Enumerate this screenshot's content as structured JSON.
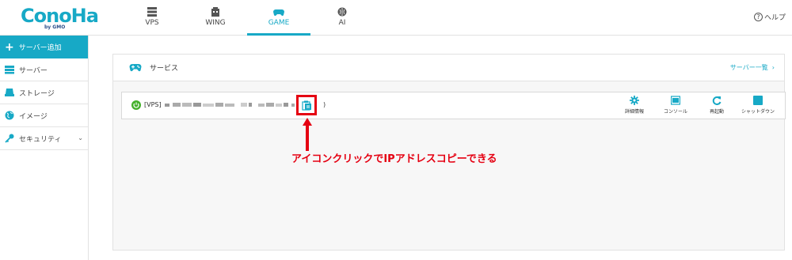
{
  "header": {
    "logo_text": "ConoHa",
    "logo_sub": "by GMO",
    "nav": [
      {
        "label": "VPS",
        "icon": "server-icon"
      },
      {
        "label": "WING",
        "icon": "building-icon"
      },
      {
        "label": "GAME",
        "icon": "gamepad-icon"
      },
      {
        "label": "AI",
        "icon": "brain-icon"
      }
    ],
    "active_nav": "GAME",
    "help_label": "ヘルプ"
  },
  "sidebar": {
    "add_label": "サーバー追加",
    "items": [
      {
        "label": "サーバー",
        "icon": "server-icon"
      },
      {
        "label": "ストレージ",
        "icon": "storage-icon"
      },
      {
        "label": "イメージ",
        "icon": "globe-icon"
      },
      {
        "label": "セキュリティ",
        "icon": "key-icon"
      }
    ]
  },
  "panel": {
    "title": "サービス",
    "list_link": "サーバー一覧",
    "server": {
      "type_label": "[VPS]",
      "paren": ")",
      "status": "running"
    },
    "actions": [
      {
        "label": "詳細情報",
        "icon": "gear-icon"
      },
      {
        "label": "コンソール",
        "icon": "console-icon"
      },
      {
        "label": "再起動",
        "icon": "restart-icon"
      },
      {
        "label": "シャットダウン",
        "icon": "shutdown-icon"
      }
    ]
  },
  "annotation": {
    "text": "アイコンクリックでIPアドレスコピーできる"
  },
  "colors": {
    "accent": "#17a9c6",
    "highlight": "#e50012",
    "power_on": "#43b02a"
  }
}
